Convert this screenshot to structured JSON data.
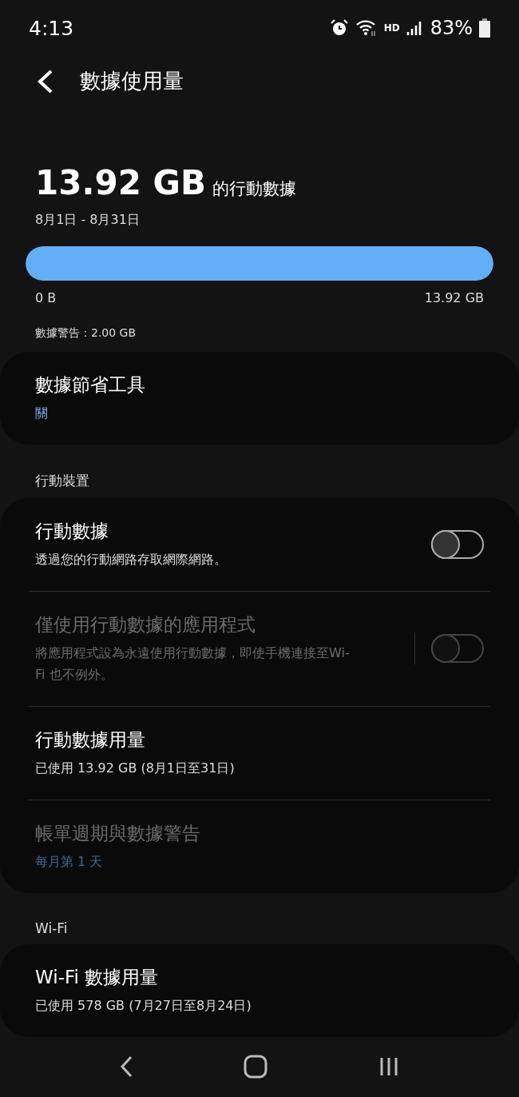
{
  "status_bar": {
    "time": "4:13",
    "network": "HD",
    "battery": "83%"
  },
  "header": {
    "title": "數據使用量"
  },
  "summary": {
    "amount": "13.92 GB",
    "suffix": "的行動數據",
    "period": "8月1日 - 8月31日",
    "level": 1,
    "min_label": "0 B",
    "max_label": "13.92 GB",
    "warning": "數據警告：2.00 GB"
  },
  "sections": [
    {
      "rows": [
        {
          "kind": "link",
          "title": "數據節省工具",
          "subtitle": "關",
          "accent": true,
          "disabled": false
        }
      ]
    },
    {
      "header": "行動裝置",
      "rows": [
        {
          "kind": "toggle",
          "title": "行動數據",
          "subtitle": "透過您的行動網路存取網際網路。",
          "on": false,
          "disabled": false,
          "divider": false
        },
        {
          "kind": "toggle",
          "title": "僅使用行動數據的應用程式",
          "subtitle": "將應用程式設為永遠使用行動數據，即使手機連接至Wi-Fi 也不例外。",
          "on": false,
          "disabled": true,
          "divider": true
        },
        {
          "kind": "link",
          "title": "行動數據用量",
          "subtitle": "已使用 13.92 GB (8月1日至31日)",
          "accent": false,
          "disabled": false
        },
        {
          "kind": "link",
          "title": "帳單週期與數據警告",
          "subtitle": "每月第 1 天",
          "accent": true,
          "disabled": true
        }
      ]
    },
    {
      "header": "Wi-Fi",
      "rows": [
        {
          "kind": "link",
          "title": "Wi-Fi 數據用量",
          "subtitle": "已使用 578 GB (7月27日至8月24日)",
          "accent": false,
          "disabled": false
        }
      ]
    }
  ]
}
